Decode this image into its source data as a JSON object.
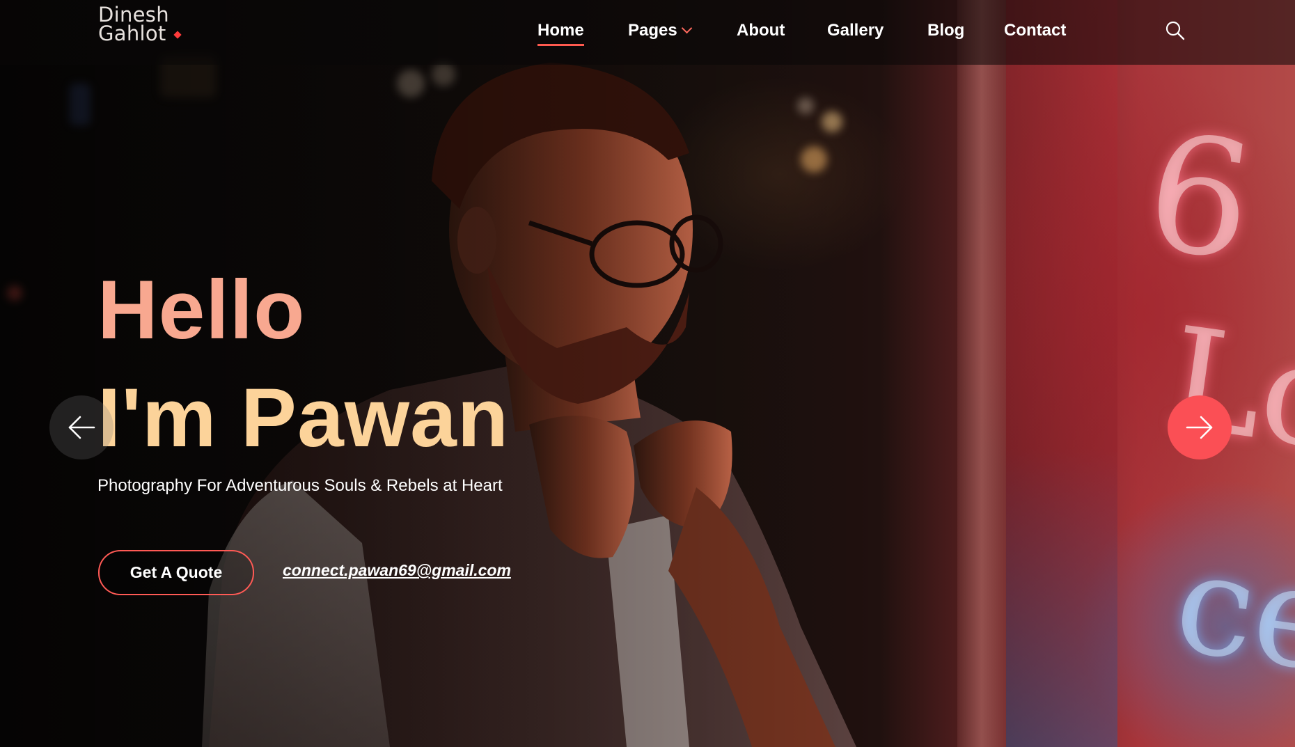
{
  "header": {
    "logo_line1": "Dinesh",
    "logo_line2": "Gahlot",
    "nav": [
      {
        "label": "Home",
        "active": true
      },
      {
        "label": "Pages",
        "has_dropdown": true
      },
      {
        "label": "About"
      },
      {
        "label": "Gallery"
      },
      {
        "label": "Blog"
      },
      {
        "label": "Contact"
      }
    ],
    "search_icon": "search-icon"
  },
  "hero": {
    "greeting": "Hello",
    "name_line": "I'm Pawan",
    "tagline": "Photography For Adventurous Souls & Rebels at Heart",
    "cta_label": "Get A Quote",
    "email": "connect.pawan69@gmail.com",
    "prev_icon": "arrow-left-icon",
    "next_icon": "arrow-right-icon"
  },
  "colors": {
    "accent": "#fb4f55",
    "greeting": "#f8a890",
    "name": "#fcd39a"
  }
}
